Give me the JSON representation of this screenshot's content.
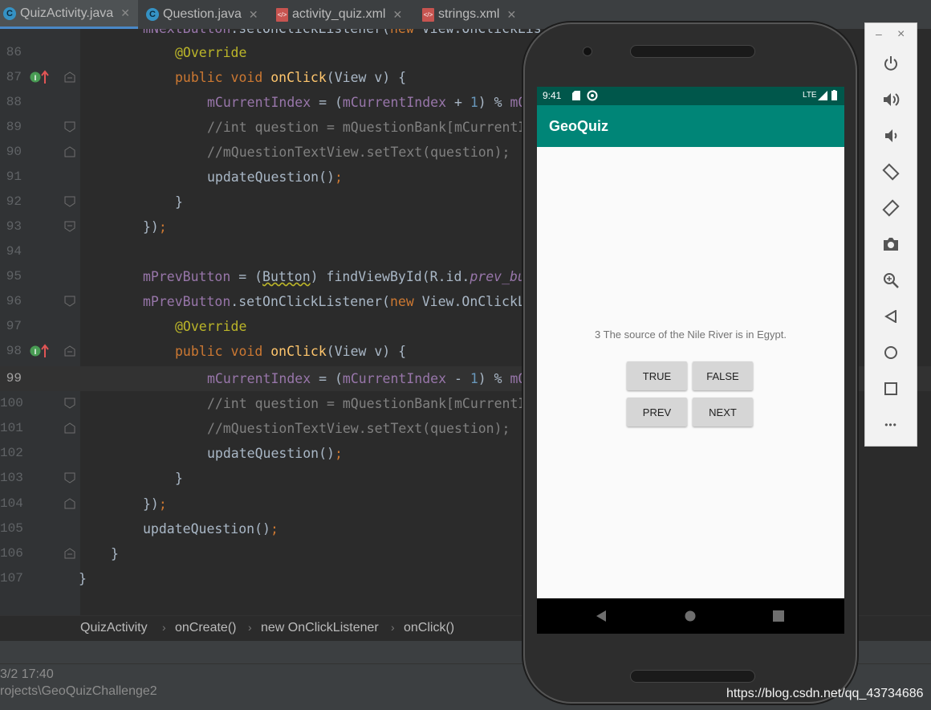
{
  "tabs": [
    {
      "label": "QuizActivity.java",
      "icon": "java-class-icon",
      "active": true
    },
    {
      "label": "Question.java",
      "icon": "java-class-icon",
      "active": false
    },
    {
      "label": "activity_quiz.xml",
      "icon": "xml-file-icon",
      "active": false
    },
    {
      "label": "strings.xml",
      "icon": "xml-file-icon",
      "active": false
    }
  ],
  "editor": {
    "current_line": "99",
    "lines": [
      {
        "num": "86"
      },
      {
        "num": "87"
      },
      {
        "num": "88"
      },
      {
        "num": "89"
      },
      {
        "num": "90"
      },
      {
        "num": "91"
      },
      {
        "num": "92"
      },
      {
        "num": "93"
      },
      {
        "num": "94"
      },
      {
        "num": "95"
      },
      {
        "num": "96"
      },
      {
        "num": "97"
      },
      {
        "num": "98"
      },
      {
        "num": "99"
      },
      {
        "num": "100"
      },
      {
        "num": "101"
      },
      {
        "num": "102"
      },
      {
        "num": "103"
      },
      {
        "num": "104"
      },
      {
        "num": "105"
      },
      {
        "num": "106"
      },
      {
        "num": "107"
      }
    ]
  },
  "breadcrumb": [
    "QuizActivity",
    "onCreate()",
    "new OnClickListener",
    "onClick()"
  ],
  "bottom_panel": {
    "timestamp": "3/2 17:40",
    "path": "rojects\\GeoQuizChallenge2"
  },
  "watermark": "https://blog.csdn.net/qq_43734686",
  "emulator": {
    "status_time": "9:41",
    "status_network": "LTE",
    "app_title": "GeoQuiz",
    "question_text": "3 The source of the Nile River is in Egypt.",
    "buttons": {
      "true": "TRUE",
      "false": "FALSE",
      "prev": "PREV",
      "next": "NEXT"
    }
  },
  "emulator_toolbar": {
    "minimize": "–",
    "close": "×",
    "more": "•••",
    "tools": [
      "power-icon",
      "volume-up-icon",
      "volume-down-icon",
      "rotate-left-icon",
      "rotate-right-icon",
      "camera-icon",
      "zoom-icon",
      "back-icon",
      "home-icon",
      "overview-icon"
    ]
  },
  "colors": {
    "app_bar": "#008577",
    "status_bar": "#00574b",
    "editor_bg": "#2b2b2b",
    "gutter_bg": "#313335"
  }
}
